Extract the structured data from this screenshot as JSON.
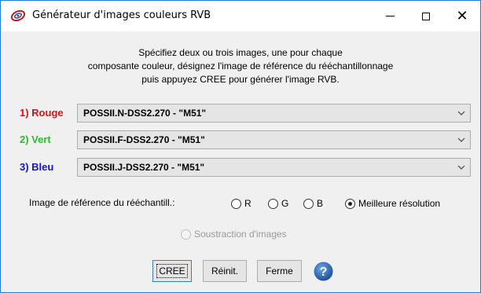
{
  "window": {
    "title": "Générateur d'images couleurs RVB",
    "icon": "aladin-logo-icon"
  },
  "instructions": {
    "line1": "Spécifiez deux ou trois images, une pour chaque",
    "line2": "composante couleur, désignez l'image de référence du rééchantillonnage",
    "line3": "puis appuyez CREE pour générer l'image RVB."
  },
  "channels": [
    {
      "label": "1) Rouge",
      "value": "POSSII.N-DSS2.270 - \"M51\"",
      "color": "#e01010"
    },
    {
      "label": "2) Vert",
      "value": "POSSII.F-DSS2.270 - \"M51\"",
      "color": "#22c322"
    },
    {
      "label": "3) Bleu",
      "value": "POSSII.J-DSS2.270 - \"M51\"",
      "color": "#1414c8"
    }
  ],
  "reference": {
    "label": "Image de référence du rééchantill.:",
    "options": [
      "R",
      "G",
      "B",
      "Meilleure résolution"
    ],
    "selected": "Meilleure résolution"
  },
  "subtraction": {
    "label": "Soustraction d'images",
    "enabled": false
  },
  "buttons": {
    "create": "CREE",
    "reset": "Réinit.",
    "close": "Ferme"
  },
  "colors": {
    "accent": "#1f7fd6",
    "help": "#2f6db5"
  }
}
